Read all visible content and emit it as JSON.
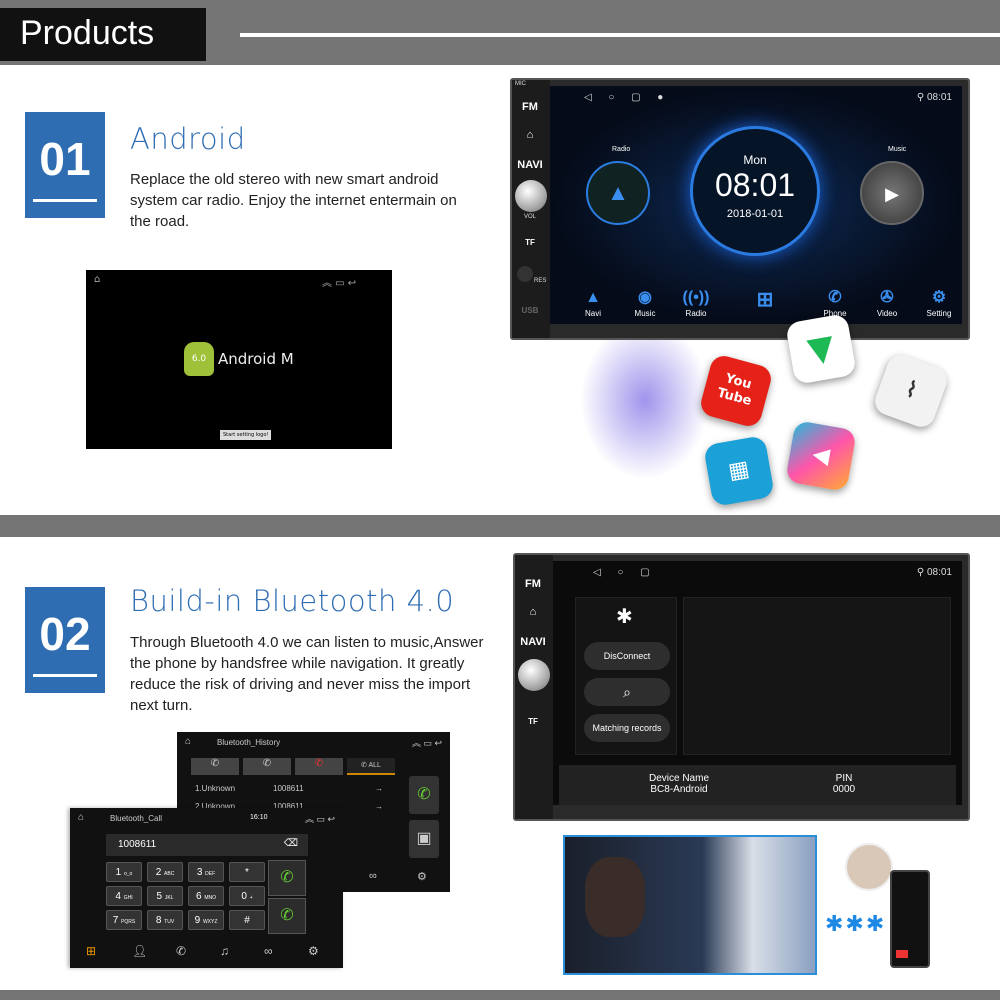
{
  "header": {
    "title": "Products"
  },
  "section1": {
    "number": "01",
    "title": "Android",
    "description": "Replace the old stereo with new smart android system car radio. Enjoy the internet entermain on the road.",
    "android_screen": {
      "logo_text": "Android M",
      "version_badge": "6.0",
      "button": "Start setting logo!"
    },
    "head_unit": {
      "buttons": [
        "FM",
        "NAVI"
      ],
      "vol_label": "VOL",
      "tf_label": "TF",
      "res_label": "RES",
      "usb_label": "USB",
      "mic_label": "MIC",
      "status_time": "08:01",
      "radio_label": "Radio",
      "music_label": "Music",
      "day": "Mon",
      "clock": "08:01",
      "date": "2018-01-01",
      "dock": [
        {
          "label": "Navi",
          "icon": "navigation-arrow-icon"
        },
        {
          "label": "Music",
          "icon": "music-disc-icon"
        },
        {
          "label": "Radio",
          "icon": "radio-tower-icon"
        },
        {
          "label": "",
          "icon": "apps-grid-icon"
        },
        {
          "label": "Phone",
          "icon": "phone-icon"
        },
        {
          "label": "Video",
          "icon": "film-reel-icon"
        },
        {
          "label": "Setting",
          "icon": "gear-icon"
        }
      ]
    },
    "apps": [
      {
        "name": "YouTube",
        "text": "You Tube",
        "color": "#e62117"
      },
      {
        "name": "play-store",
        "color": "#ffffff"
      },
      {
        "name": "audio-wave",
        "color": "#f2f2f2"
      },
      {
        "name": "calendar-app",
        "color": "#1ba0d8"
      },
      {
        "name": "video-player",
        "color": "#ff5a36"
      }
    ]
  },
  "section2": {
    "number": "02",
    "title": "Build-in Bluetooth 4.0",
    "description": "Through Bluetooth 4.0 we can listen to music,Answer the phone by handsfree while navigation. It greatly reduce the risk of driving and never miss the import next turn.",
    "head_unit": {
      "status_time": "08:01",
      "disconnect": "DisConnect",
      "matching": "Matching records",
      "device_name_label": "Device Name",
      "device_name": "BC8-Android",
      "pin_label": "PIN",
      "pin": "0000"
    },
    "bt_history": {
      "title": "Bluetooth_History",
      "tab_all": "ALL",
      "rows": [
        {
          "name": "1.Unknown",
          "number": "1008611"
        },
        {
          "name": "2.Unknown",
          "number": "1008611"
        }
      ]
    },
    "bt_call": {
      "title": "Bluetooth_Call",
      "time": "16:10",
      "number": "1008611",
      "keys": [
        [
          "1",
          "o_o"
        ],
        [
          "2",
          "ABC"
        ],
        [
          "3",
          "DEF"
        ],
        [
          "*",
          ""
        ],
        [
          "4",
          "GHI"
        ],
        [
          "5",
          "JKL"
        ],
        [
          "6",
          "MNO"
        ],
        [
          "0",
          "+"
        ],
        [
          "7",
          "PQRS"
        ],
        [
          "8",
          "TUV"
        ],
        [
          "9",
          "WXYZ"
        ],
        [
          "#",
          ""
        ]
      ]
    }
  }
}
